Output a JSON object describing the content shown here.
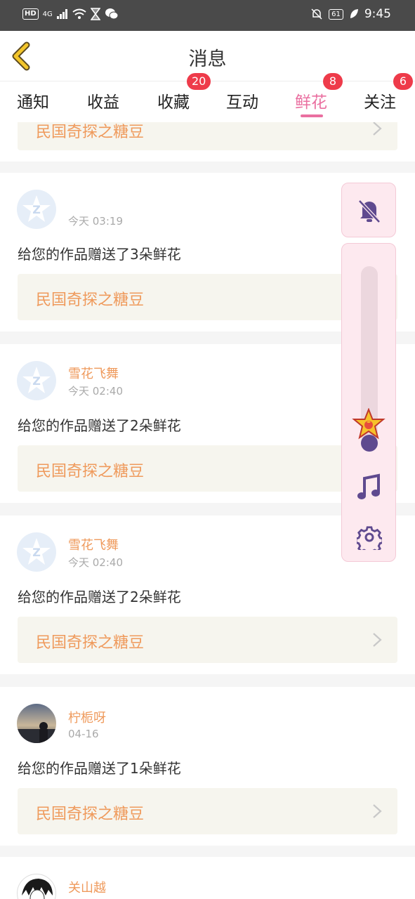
{
  "status_bar": {
    "hd": "HD",
    "network": "4G",
    "battery": "61",
    "time": "9:45"
  },
  "header": {
    "title": "消息"
  },
  "tabs": [
    {
      "label": "通知",
      "badge": null,
      "active": false
    },
    {
      "label": "收益",
      "badge": null,
      "active": false
    },
    {
      "label": "收藏",
      "badge": "20",
      "active": false
    },
    {
      "label": "互动",
      "badge": null,
      "active": false
    },
    {
      "label": "鲜花",
      "badge": "8",
      "active": true
    },
    {
      "label": "关注",
      "badge": "6",
      "active": false
    }
  ],
  "messages": [
    {
      "book": "民国奇探之糖豆"
    },
    {
      "user": "",
      "time": "今天 03:19",
      "text": "给您的作品赠送了3朵鲜花",
      "book": "民国奇探之糖豆"
    },
    {
      "user": "雪花飞舞",
      "time": "今天 02:40",
      "text": "给您的作品赠送了2朵鲜花",
      "book": "民国奇探之糖豆"
    },
    {
      "user": "雪花飞舞",
      "time": "今天 02:40",
      "text": "给您的作品赠送了2朵鲜花",
      "book": "民国奇探之糖豆"
    },
    {
      "user": "柠栀呀",
      "time": "04-16",
      "text": "给您的作品赠送了1朵鲜花",
      "book": "民国奇探之糖豆"
    },
    {
      "user": "关山越"
    }
  ],
  "floating_panel": {
    "icons": [
      "bell-off-icon",
      "music-note-icon",
      "gear-icon"
    ],
    "slider_level": 0.02,
    "colors": {
      "panel_bg": "#fde9ef",
      "icon": "#5f4a8f"
    }
  },
  "colors": {
    "accent_pink": "#ea6fa0",
    "badge_red": "#ee3b4a",
    "username_orange": "#ef9a5c",
    "link_box_bg": "#f6f5ee"
  }
}
